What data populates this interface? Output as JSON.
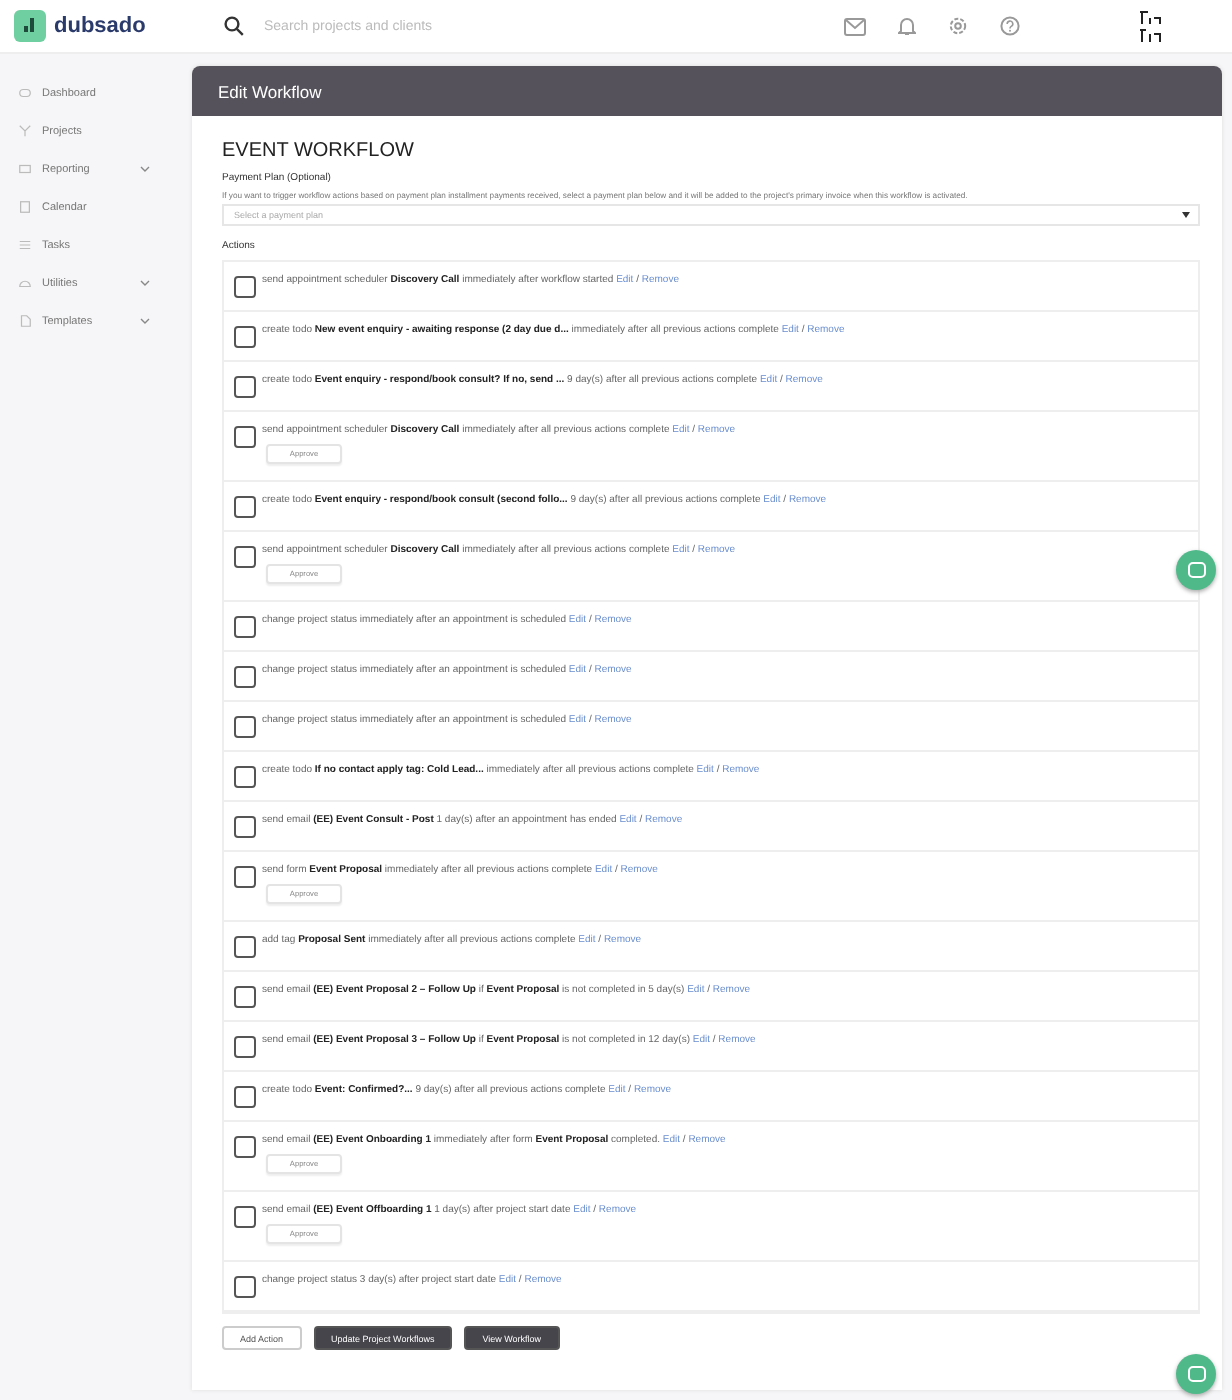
{
  "brand": {
    "name": "dubsado"
  },
  "search": {
    "placeholder": "Search projects and clients"
  },
  "sidebar": {
    "items": [
      {
        "label": "Dashboard",
        "has_submenu": false
      },
      {
        "label": "Projects",
        "has_submenu": false
      },
      {
        "label": "Reporting",
        "has_submenu": true
      },
      {
        "label": "Calendar",
        "has_submenu": false
      },
      {
        "label": "Tasks",
        "has_submenu": false
      },
      {
        "label": "Utilities",
        "has_submenu": true
      },
      {
        "label": "Templates",
        "has_submenu": true
      }
    ]
  },
  "panel": {
    "title": "Edit Workflow",
    "workflow_name": "EVENT WORKFLOW",
    "payment_plan": {
      "label": "Payment Plan (Optional)",
      "hint": "If you want to trigger workflow actions based on payment plan installment payments received, select a payment plan below and it will be added to the project's primary invoice when this workflow is activated.",
      "placeholder": "Select a payment plan"
    },
    "actions_label": "Actions",
    "actions": [
      {
        "text": "send appointment scheduler **Discovery Call** immediately after workflow started",
        "edit": "Edit",
        "separator": "/",
        "remove": "Remove",
        "checked": false
      },
      {
        "text": "create todo **New event enquiry - awaiting response (2 day due d...** immediately after all previous actions complete",
        "edit": "Edit",
        "separator": "/",
        "remove": "Remove",
        "checked": false
      },
      {
        "text": "create todo **Event enquiry - respond/book consult? If no, send ...** 9 day(s) after all previous actions complete",
        "edit": "Edit",
        "separator": "/",
        "remove": "Remove",
        "checked": false
      },
      {
        "text": "send appointment scheduler **Discovery Call** immediately after all previous actions complete",
        "edit": "Edit",
        "separator": "/",
        "remove": "Remove",
        "checked": false,
        "approve": "Approve"
      },
      {
        "text": "create todo **Event enquiry - respond/book consult (second follo...** 9 day(s) after all previous actions complete",
        "edit": "Edit",
        "separator": "/",
        "remove": "Remove",
        "checked": false
      },
      {
        "text": "send appointment scheduler **Discovery Call** immediately after all previous actions complete",
        "edit": "Edit",
        "separator": "/",
        "remove": "Remove",
        "checked": false,
        "approve": "Approve"
      },
      {
        "text": "change project status immediately after an appointment is scheduled",
        "edit": "Edit",
        "separator": "/",
        "remove": "Remove",
        "checked": false
      },
      {
        "text": "change project status immediately after an appointment is scheduled",
        "edit": "Edit",
        "separator": "/",
        "remove": "Remove",
        "checked": false
      },
      {
        "text": "change project status immediately after an appointment is scheduled",
        "edit": "Edit",
        "separator": "/",
        "remove": "Remove",
        "checked": false
      },
      {
        "text": "create todo **If no contact apply tag: Cold Lead...** immediately after all previous actions complete",
        "edit": "Edit",
        "separator": "/",
        "remove": "Remove",
        "checked": false
      },
      {
        "text": "send email **(EE) Event Consult - Post** 1 day(s) after an appointment has ended",
        "edit": "Edit",
        "separator": "/",
        "remove": "Remove",
        "checked": false
      },
      {
        "text": "send form **Event Proposal** immediately after all previous actions complete",
        "edit": "Edit",
        "separator": "/",
        "remove": "Remove",
        "checked": false,
        "approve": "Approve"
      },
      {
        "text": "add tag **Proposal Sent** immediately after all previous actions complete",
        "edit": "Edit",
        "separator": "/",
        "remove": "Remove",
        "checked": false
      },
      {
        "text": "send email **(EE) Event Proposal 2 – Follow Up** if **Event Proposal** is not completed in 5 day(s)",
        "edit": "Edit",
        "separator": "/",
        "remove": "Remove",
        "checked": false
      },
      {
        "text": "send email **(EE) Event Proposal 3 – Follow Up** if **Event Proposal** is not completed in 12 day(s)",
        "edit": "Edit",
        "separator": "/",
        "remove": "Remove",
        "checked": false
      },
      {
        "text": "create todo **Event: Confirmed?...** 9 day(s) after all previous actions complete",
        "edit": "Edit",
        "separator": "/",
        "remove": "Remove",
        "checked": false
      },
      {
        "text": "send email **(EE) Event Onboarding 1** immediately after form **Event Proposal** completed.",
        "edit": "Edit",
        "separator": "/",
        "remove": "Remove",
        "checked": false,
        "approve": "Approve"
      },
      {
        "text": "send email **(EE) Event Offboarding 1** 1 day(s) after project start date",
        "edit": "Edit",
        "separator": "/",
        "remove": "Remove",
        "checked": false,
        "approve": "Approve"
      },
      {
        "text": "change project status 3 day(s) after project start date",
        "edit": "Edit",
        "separator": "/",
        "remove": "Remove",
        "checked": false
      }
    ],
    "buttons": [
      {
        "label": "Add Action",
        "kind": "secondary"
      },
      {
        "label": "Update Project Workflows",
        "kind": "primary"
      },
      {
        "label": "View Workflow",
        "kind": "primary"
      }
    ]
  }
}
